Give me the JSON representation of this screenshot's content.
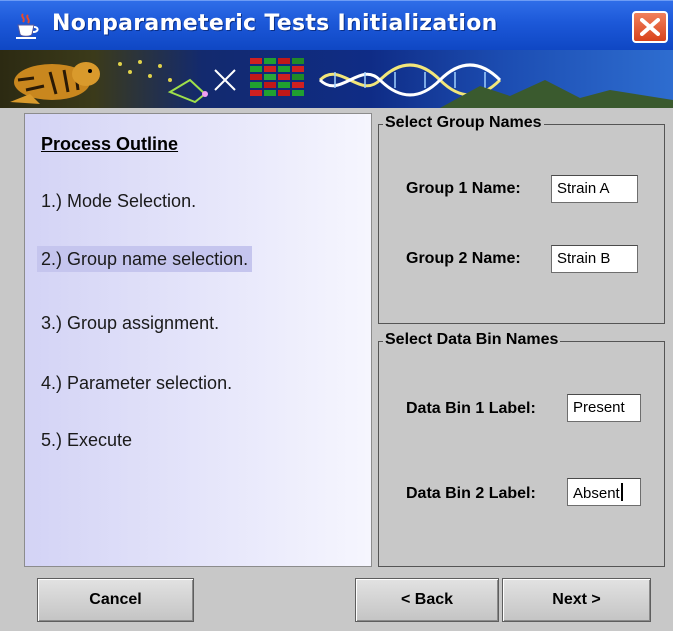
{
  "window": {
    "title": "Nonparameteric Tests Initialization"
  },
  "outline": {
    "title": "Process Outline",
    "steps": [
      "1.) Mode Selection.",
      "2.) Group name selection.",
      "3.) Group assignment.",
      "4.) Parameter selection.",
      "5.) Execute"
    ],
    "active_step": 2
  },
  "group_names": {
    "legend": "Select Group Names",
    "group1_label": "Group 1 Name:",
    "group1_value": "Strain A",
    "group2_label": "Group 2 Name:",
    "group2_value": "Strain B"
  },
  "data_bins": {
    "legend": "Select Data Bin Names",
    "bin1_label": "Data Bin 1 Label:",
    "bin1_value": "Present",
    "bin2_label": "Data Bin 2 Label:",
    "bin2_value": "Absent"
  },
  "buttons": {
    "cancel": "Cancel",
    "back": "< Back",
    "next": "Next >"
  },
  "icons": {
    "app": "java-cup-icon",
    "close": "close-icon"
  },
  "colors": {
    "titlebar": "#1c58d8",
    "close_button": "#d9431c",
    "panel_background": "#c8c8c8",
    "outline_panel": "#e8e8fb",
    "active_step": "#c5c5ee"
  }
}
